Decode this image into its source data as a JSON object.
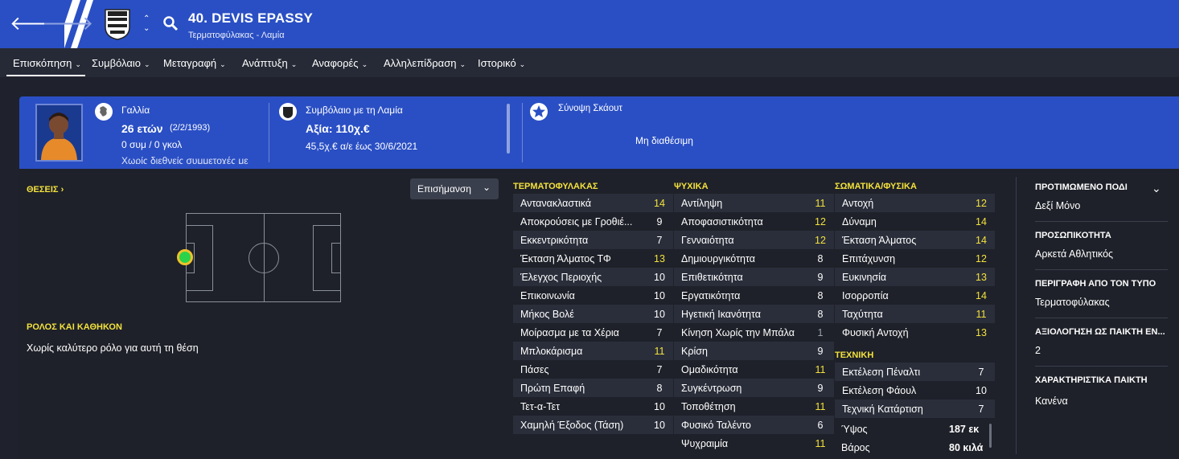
{
  "header": {
    "title": "40. DEVIS EPASSY",
    "subtitle": "Τερματοφύλακας - Λαμία"
  },
  "menu": [
    {
      "label": "Επισκόπηση"
    },
    {
      "label": "Συμβόλαιο"
    },
    {
      "label": "Μεταγραφή"
    },
    {
      "label": "Ανάπτυξη"
    },
    {
      "label": "Αναφορές"
    },
    {
      "label": "Αλληλεπίδραση"
    },
    {
      "label": "Ιστορικό"
    }
  ],
  "profile": {
    "nation": "Γαλλία",
    "age": "26 ετών",
    "dob": "(2/2/1993)",
    "caps": "0 συμ / 0 γκολ",
    "intl": "Χωρίς διεθνείς συμμετοχές με",
    "contract_title": "Συμβόλαιο με τη Λαμία",
    "value": "Αξία: 110χ.€",
    "wage": "45,5χ.€ α/ε έως 30/6/2021",
    "scout_title": "Σύνοψη Σκάουτ",
    "scout_value": "Μη διαθέσιμη"
  },
  "positions": {
    "label": "ΘΕΣΕΙΣ",
    "dropdown": "Επισήμανση",
    "role_label": "ΡΟΛΟΣ ΚΑΙ ΚΑΘΗΚΟΝ",
    "role_text": "Χωρίς καλύτερο ρόλο για αυτή τη θέση"
  },
  "goalkeeping": {
    "heading": "ΤΕΡΜΑΤΟΦΥΛΑΚΑΣ",
    "rows": [
      {
        "name": "Αντανακλαστικά",
        "value": "14"
      },
      {
        "name": "Αποκρούσεις με Γροθιέ...",
        "value": "9"
      },
      {
        "name": "Εκκεντρικότητα",
        "value": "7"
      },
      {
        "name": "Έκταση Άλματος ΤΦ",
        "value": "13"
      },
      {
        "name": "Έλεγχος Περιοχής",
        "value": "10"
      },
      {
        "name": "Επικοινωνία",
        "value": "10"
      },
      {
        "name": "Μήκος Βολέ",
        "value": "10"
      },
      {
        "name": "Μοίρασμα με τα Χέρια",
        "value": "7"
      },
      {
        "name": "Μπλοκάρισμα",
        "value": "11"
      },
      {
        "name": "Πάσες",
        "value": "7"
      },
      {
        "name": "Πρώτη Επαφή",
        "value": "8"
      },
      {
        "name": "Τετ-α-Τετ",
        "value": "10"
      },
      {
        "name": "Χαμηλή Έξοδος (Τάση)",
        "value": "10"
      }
    ]
  },
  "mental": {
    "heading": "ΨΥΧΙΚΑ",
    "rows": [
      {
        "name": "Αντίληψη",
        "value": "11"
      },
      {
        "name": "Αποφασιστικότητα",
        "value": "12"
      },
      {
        "name": "Γενναιότητα",
        "value": "12"
      },
      {
        "name": "Δημιουργικότητα",
        "value": "8"
      },
      {
        "name": "Επιθετικότητα",
        "value": "9"
      },
      {
        "name": "Εργατικότητα",
        "value": "8"
      },
      {
        "name": "Ηγετική Ικανότητα",
        "value": "8"
      },
      {
        "name": "Κίνηση Χωρίς την Μπάλα",
        "value": "1"
      },
      {
        "name": "Κρίση",
        "value": "9"
      },
      {
        "name": "Ομαδικότητα",
        "value": "11"
      },
      {
        "name": "Συγκέντρωση",
        "value": "9"
      },
      {
        "name": "Τοποθέτηση",
        "value": "11"
      },
      {
        "name": "Φυσικό Ταλέντο",
        "value": "6"
      },
      {
        "name": "Ψυχραιμία",
        "value": "11"
      }
    ]
  },
  "physical": {
    "heading": "ΣΩΜΑΤΙΚΑ/ΦΥΣΙΚΑ",
    "rows": [
      {
        "name": "Αντοχή",
        "value": "12"
      },
      {
        "name": "Δύναμη",
        "value": "14"
      },
      {
        "name": "Έκταση Άλματος",
        "value": "14"
      },
      {
        "name": "Επιτάχυνση",
        "value": "12"
      },
      {
        "name": "Ευκινησία",
        "value": "13"
      },
      {
        "name": "Ισορροπία",
        "value": "14"
      },
      {
        "name": "Ταχύτητα",
        "value": "11"
      },
      {
        "name": "Φυσική Αντοχή",
        "value": "13"
      }
    ]
  },
  "technical": {
    "heading": "ΤΕΧΝΙΚΗ",
    "rows": [
      {
        "name": "Εκτέλεση Πέναλτι",
        "value": "7"
      },
      {
        "name": "Εκτέλεση Φάουλ",
        "value": "10"
      },
      {
        "name": "Τεχνική Κατάρτιση",
        "value": "7"
      }
    ]
  },
  "body": {
    "height_label": "Ύψος",
    "height": "187 εκ",
    "weight_label": "Βάρος",
    "weight": "80 κιλά"
  },
  "info": [
    {
      "heading": "ΠΡΟΤΙΜΩΜΕΝΟ ΠΟΔΙ",
      "value": "Δεξί Μόνο"
    },
    {
      "heading": "ΠΡΟΣΩΠΙΚΟΤΗΤΑ",
      "value": "Αρκετά Αθλητικός"
    },
    {
      "heading": "ΠΕΡΙΓΡΑΦΗ ΑΠΟ ΤΟΝ ΤΥΠΟ",
      "value": "Τερματοφύλακας"
    },
    {
      "heading": "ΑΞΙΟΛΟΓΗΣΗ ΩΣ ΠΑΙΚΤΗ ΕΝ...",
      "value": "2"
    },
    {
      "heading": "ΧΑΡΑΚΤΗΡΙΣΤΙΚΑ ΠΑΙΚΤΗ",
      "value": "Κανένα"
    }
  ],
  "colors": {
    "header_blue": "#2a4fc4",
    "highlight_yellow": "#f3e13d",
    "background": "#1e2129"
  }
}
